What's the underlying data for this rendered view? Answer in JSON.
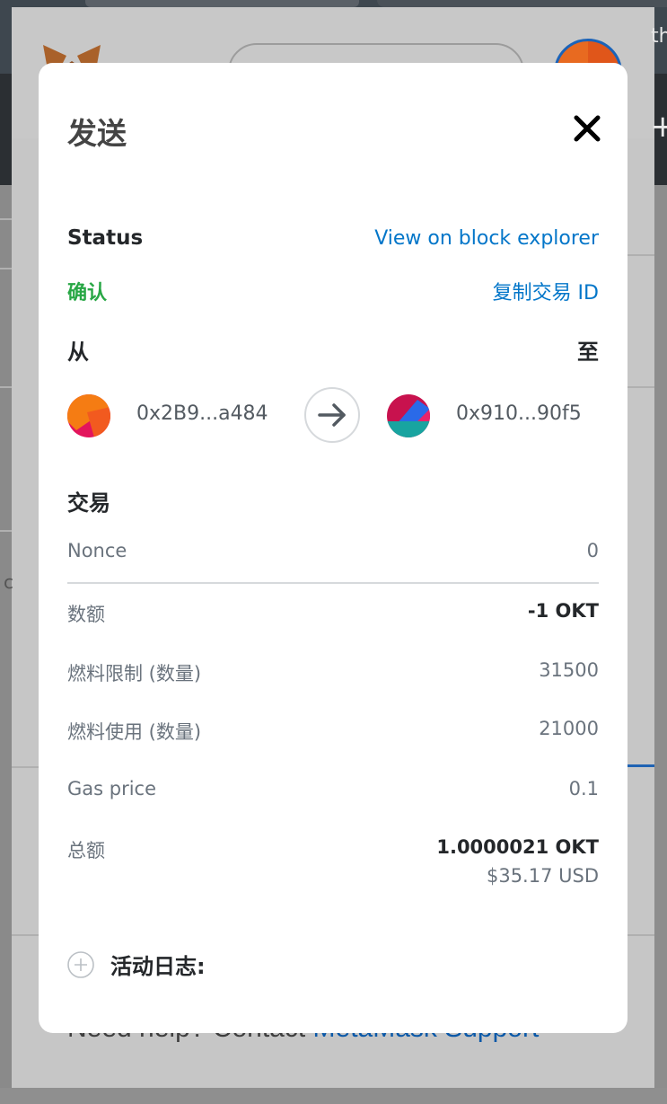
{
  "modal": {
    "title": "发送",
    "close_icon": "close-icon",
    "status": {
      "label": "Status",
      "explorer_link": "View on block explorer",
      "value": "确认",
      "copy_link": "复制交易 ID"
    },
    "from_label": "从",
    "to_label": "至",
    "from_address": "0x2B9...a484",
    "to_address": "0x910...90f5",
    "transaction": {
      "title": "交易",
      "rows": [
        {
          "label": "Nonce",
          "value": "0"
        },
        {
          "label": "数额",
          "value": "-1 OKT"
        },
        {
          "label": "燃料限制 (数量)",
          "value": "31500"
        },
        {
          "label": "燃料使用 (数量)",
          "value": "21000"
        },
        {
          "label": "Gas price",
          "value": "0.1"
        }
      ],
      "total_label": "总额",
      "total_value": "1.0000021 OKT",
      "total_fiat": "$35.17 USD"
    },
    "activity_log_label": "活动日志:"
  },
  "background": {
    "help_text": "Need help? Contact ",
    "help_link": "MetaMask Support",
    "right_edge_text": "th",
    "chip_text": "0",
    "side_text": "c"
  },
  "colors": {
    "link": "#0376c9",
    "confirmed": "#28a745",
    "text_dark": "#24272a",
    "text_muted": "#6a737d"
  }
}
